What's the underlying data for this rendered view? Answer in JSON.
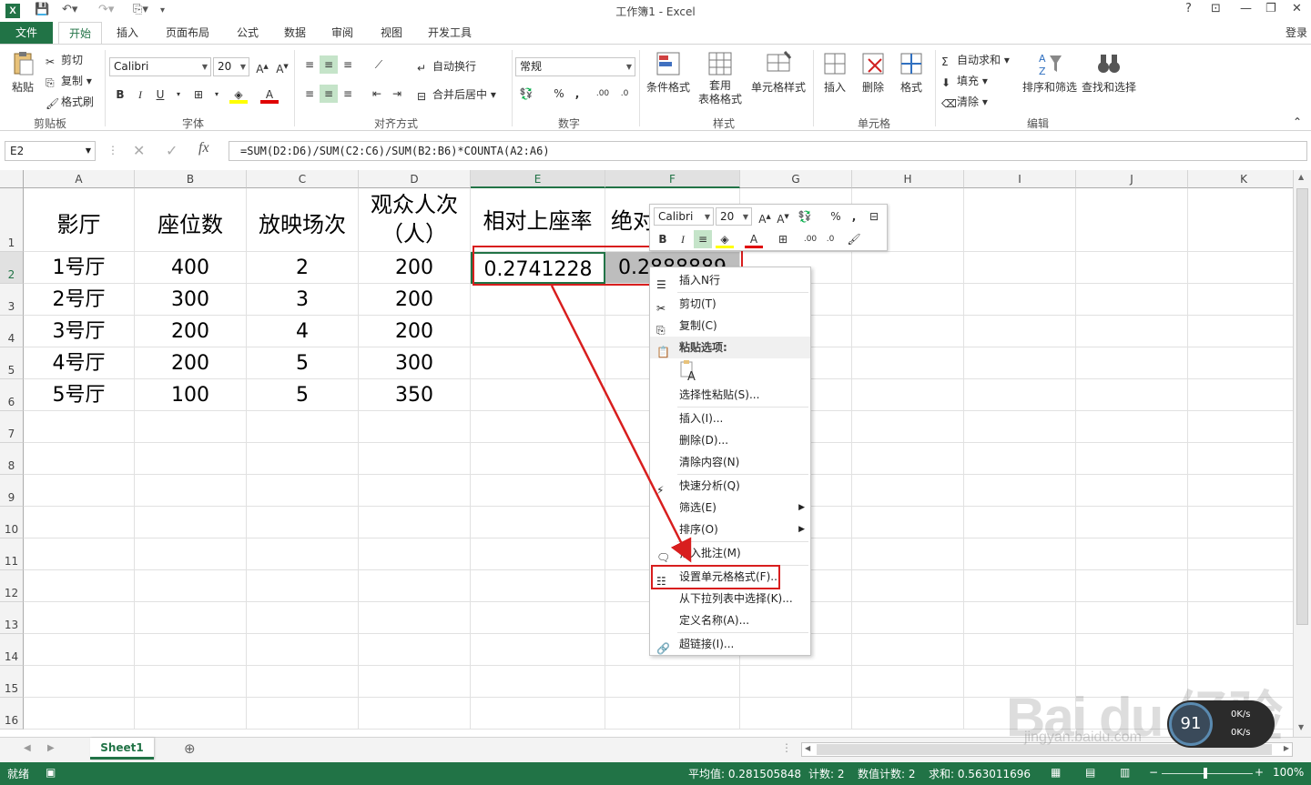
{
  "window": {
    "title": "工作簿1 - Excel",
    "help": "?",
    "login": "登录"
  },
  "tabs": [
    "文件",
    "开始",
    "插入",
    "页面布局",
    "公式",
    "数据",
    "审阅",
    "视图",
    "开发工具"
  ],
  "ribbon": {
    "clipboard": {
      "paste": "粘贴",
      "cut": "剪切",
      "copy": "复制",
      "format_painter": "格式刷",
      "label": "剪贴板"
    },
    "font": {
      "name": "Calibri",
      "size": "20",
      "label": "字体",
      "bold": "B",
      "italic": "I",
      "underline": "U"
    },
    "alignment": {
      "wrap": "自动换行",
      "merge": "合并后居中",
      "label": "对齐方式"
    },
    "number": {
      "format": "常规",
      "percent": "%",
      "comma": ",",
      "label": "数字"
    },
    "styles": {
      "conditional": "条件格式",
      "table": "套用",
      "table2": "表格格式",
      "cell_styles": "单元格样式",
      "label": "样式"
    },
    "cells": {
      "insert": "插入",
      "delete": "删除",
      "format": "格式",
      "label": "单元格"
    },
    "editing": {
      "autosum": "自动求和",
      "fill": "填充",
      "clear": "清除",
      "sort": "排序和筛选",
      "find": "查找和选择",
      "label": "编辑"
    }
  },
  "formula_bar": {
    "name_box": "E2",
    "fx": "fx",
    "formula": "=SUM(D2:D6)/SUM(C2:C6)/SUM(B2:B6)*COUNTA(A2:A6)"
  },
  "columns": [
    "A",
    "B",
    "C",
    "D",
    "E",
    "F",
    "G",
    "H",
    "I",
    "J",
    "K"
  ],
  "rows": [
    "1",
    "2",
    "3",
    "4",
    "5",
    "6",
    "7",
    "8",
    "9",
    "10",
    "11",
    "12",
    "13",
    "14",
    "15",
    "16"
  ],
  "headers": {
    "a": "影厅",
    "b": "座位数",
    "c": "放映场次",
    "d_line1": "观众人次",
    "d_line2": "（人）",
    "e": "相对上座率",
    "f": "绝对"
  },
  "data_rows": [
    {
      "a": "1号厅",
      "b": "400",
      "c": "2",
      "d": "200"
    },
    {
      "a": "2号厅",
      "b": "300",
      "c": "3",
      "d": "200"
    },
    {
      "a": "3号厅",
      "b": "200",
      "c": "4",
      "d": "200"
    },
    {
      "a": "4号厅",
      "b": "200",
      "c": "5",
      "d": "300"
    },
    {
      "a": "5号厅",
      "b": "100",
      "c": "5",
      "d": "350"
    }
  ],
  "e2": "0.2741228",
  "f2": "0.2888889",
  "mini_toolbar": {
    "font": "Calibri",
    "size": "20",
    "bold": "B",
    "italic": "I",
    "percent": "%",
    "comma": ","
  },
  "context_menu": {
    "insert_row": "插入N行",
    "cut": "剪切(T)",
    "copy": "复制(C)",
    "paste_options": "粘贴选项:",
    "paste_special": "选择性粘贴(S)...",
    "insert": "插入(I)...",
    "delete": "删除(D)...",
    "clear": "清除内容(N)",
    "quick_analysis": "快速分析(Q)",
    "filter": "筛选(E)",
    "sort": "排序(O)",
    "insert_comment": "插入批注(M)",
    "format_cells": "设置单元格格式(F)...",
    "pick_list": "从下拉列表中选择(K)...",
    "define_name": "定义名称(A)...",
    "hyperlink": "超链接(I)..."
  },
  "sheet_tab": "Sheet1",
  "status": {
    "ready": "就绪",
    "average": "平均值: 0.281505848",
    "count": "计数: 2",
    "numeric_count": "数值计数: 2",
    "sum": "求和: 0.563011696",
    "zoom": "100%"
  },
  "watermark": {
    "brand": "Bai du 经验",
    "url": "jingyan.baidu.com"
  },
  "speed_widget": {
    "percent": "91",
    "up": "0K/s",
    "down": "0K/s"
  },
  "colors": {
    "excel_green": "#217346",
    "annotation_red": "#d81e1e"
  }
}
